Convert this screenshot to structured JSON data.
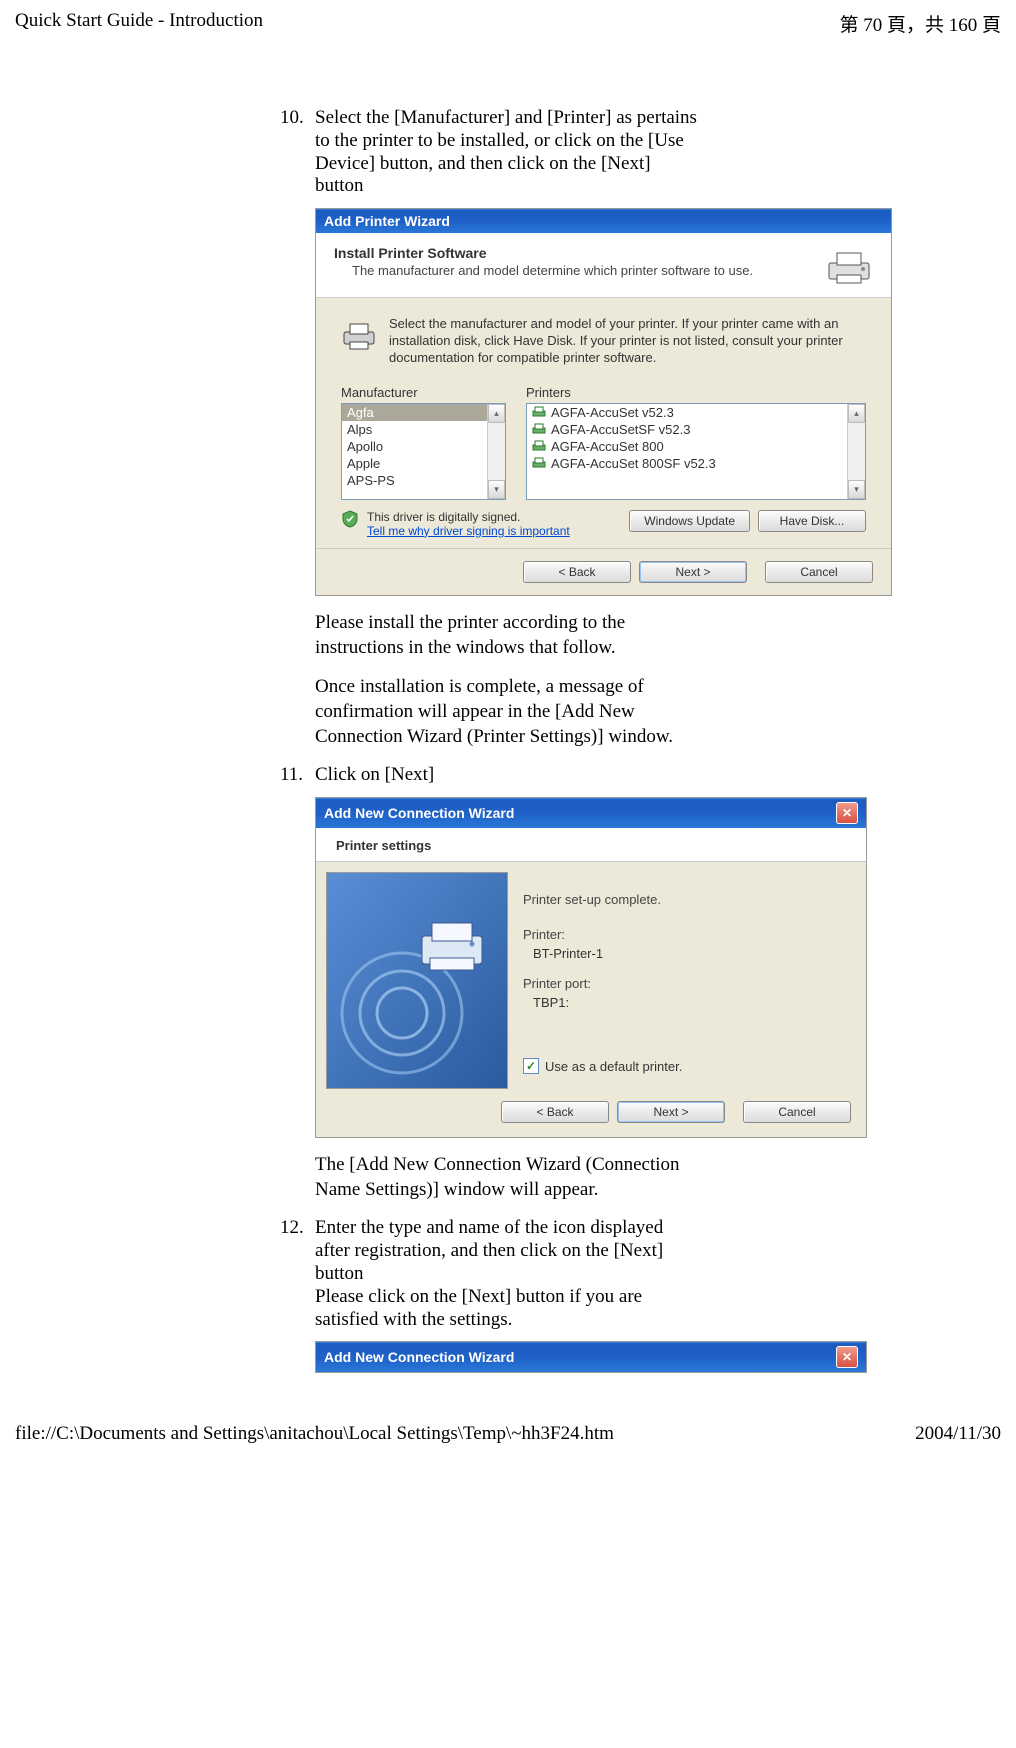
{
  "header": {
    "left": "Quick Start Guide - Introduction",
    "right": "第 70 頁，共 160 頁"
  },
  "footer": {
    "left": "file://C:\\Documents and Settings\\anitachou\\Local Settings\\Temp\\~hh3F24.htm",
    "right": "2004/11/30"
  },
  "steps": {
    "s10": {
      "num": "10.",
      "text": "Select the [Manufacturer] and [Printer] as pertains to the printer to be installed, or click on the [Use Device] button, and then click on the [Next] button"
    },
    "s11": {
      "num": "11.",
      "text": "Click on [Next]"
    },
    "s12": {
      "num": "12.",
      "text": "Enter the type and name of the icon displayed after registration, and then click on the [Next] button",
      "text2": "Please click on the [Next] button if you are satisfied with the settings."
    }
  },
  "body": {
    "p1": "Please install the printer according to the instructions in the windows that follow.",
    "p2": "Once installation is complete, a message of confirmation will appear in the [Add New Connection Wizard (Printer Settings)] window.",
    "p3": "The [Add New Connection Wizard (Connection Name Settings)] window will appear."
  },
  "dialog1": {
    "title": "Add Printer Wizard",
    "heading": "Install Printer Software",
    "subheading": "The manufacturer and model determine which printer software to use.",
    "desc": "Select the manufacturer and model of your printer. If your printer came with an installation disk, click Have Disk. If your printer is not listed, consult your printer documentation for compatible printer software.",
    "manufacturer_label": "Manufacturer",
    "printers_label": "Printers",
    "manufacturers": [
      "Agfa",
      "Alps",
      "Apollo",
      "Apple",
      "APS-PS"
    ],
    "printers": [
      "AGFA-AccuSet v52.3",
      "AGFA-AccuSetSF v52.3",
      "AGFA-AccuSet 800",
      "AGFA-AccuSet 800SF v52.3"
    ],
    "signed_text": "This driver is digitally signed.",
    "signing_link": "Tell me why driver signing is important",
    "btn_update": "Windows Update",
    "btn_disk": "Have Disk...",
    "btn_back": "< Back",
    "btn_next": "Next >",
    "btn_cancel": "Cancel"
  },
  "dialog2": {
    "title": "Add New Connection Wizard",
    "subtitle": "Printer settings",
    "complete": "Printer set-up complete.",
    "printer_label": "Printer:",
    "printer_value": "BT-Printer-1",
    "port_label": "Printer port:",
    "port_value": "TBP1:",
    "default_check": "Use as a default printer.",
    "btn_back": "< Back",
    "btn_next": "Next >",
    "btn_cancel": "Cancel"
  },
  "dialog3": {
    "title": "Add New Connection Wizard"
  }
}
